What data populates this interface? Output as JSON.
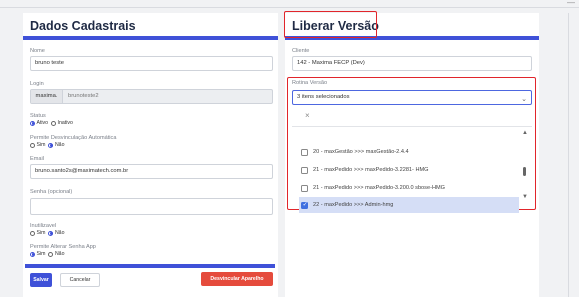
{
  "left": {
    "title": "Dados Cadastrais",
    "nome": {
      "label": "Nome",
      "value": "bruno teste"
    },
    "login": {
      "label": "Login",
      "prefix": "maxima.",
      "value": "brunoteste2"
    },
    "status": {
      "label": "Status",
      "options": [
        "Ativo",
        "Inativo"
      ],
      "selected": "Ativo"
    },
    "desvinc": {
      "label": "Permite Desvinculação Automática",
      "options": [
        "Sim",
        "Não"
      ],
      "selected": "Não"
    },
    "email": {
      "label": "Email",
      "value": "bruno.santo2s@maximatech.com.br"
    },
    "senha": {
      "label": "Senha (opcional)",
      "value": ""
    },
    "inutilizavel": {
      "label": "Inutilizavel",
      "options": [
        "Sim",
        "Não"
      ],
      "selected": "Não"
    },
    "alterar_senha": {
      "label": "Permite Alterar Senha App",
      "options": [
        "Sim",
        "Não"
      ],
      "selected": "Sim"
    },
    "buttons": {
      "save": "Salvar",
      "cancel": "Cancelar",
      "unlink": "Desvincular Aparelho"
    }
  },
  "right": {
    "title": "Liberar Versão",
    "cliente": {
      "label": "Cliente",
      "value": "142 - Maxima FECP (Dev)"
    },
    "rotina": {
      "label": "Rotina Versão",
      "selected_text": "3 itens selecionados",
      "clear_symbol": "×",
      "options": [
        {
          "label": "20 - maxGestão >>> maxGestão-2.4.4",
          "checked": false
        },
        {
          "label": "21 - maxPedido >>> maxPedido-3.2281- HMG",
          "checked": false
        },
        {
          "label": "21 - maxPedido >>> maxPedido-3.200.0 sbose-HMG",
          "checked": false
        },
        {
          "label": "22 - maxPedido >>> Admin-hmg",
          "checked": true
        }
      ]
    }
  },
  "colors": {
    "accent": "#3f51d8",
    "danger": "#e1252b",
    "highlight": "#e1252b",
    "selected_row": "#d5def6"
  },
  "icons": {
    "chevron": "chevron-down-icon",
    "clear": "close-icon",
    "scroll_up": "triangle-up-icon",
    "scroll_down": "triangle-down-icon"
  }
}
